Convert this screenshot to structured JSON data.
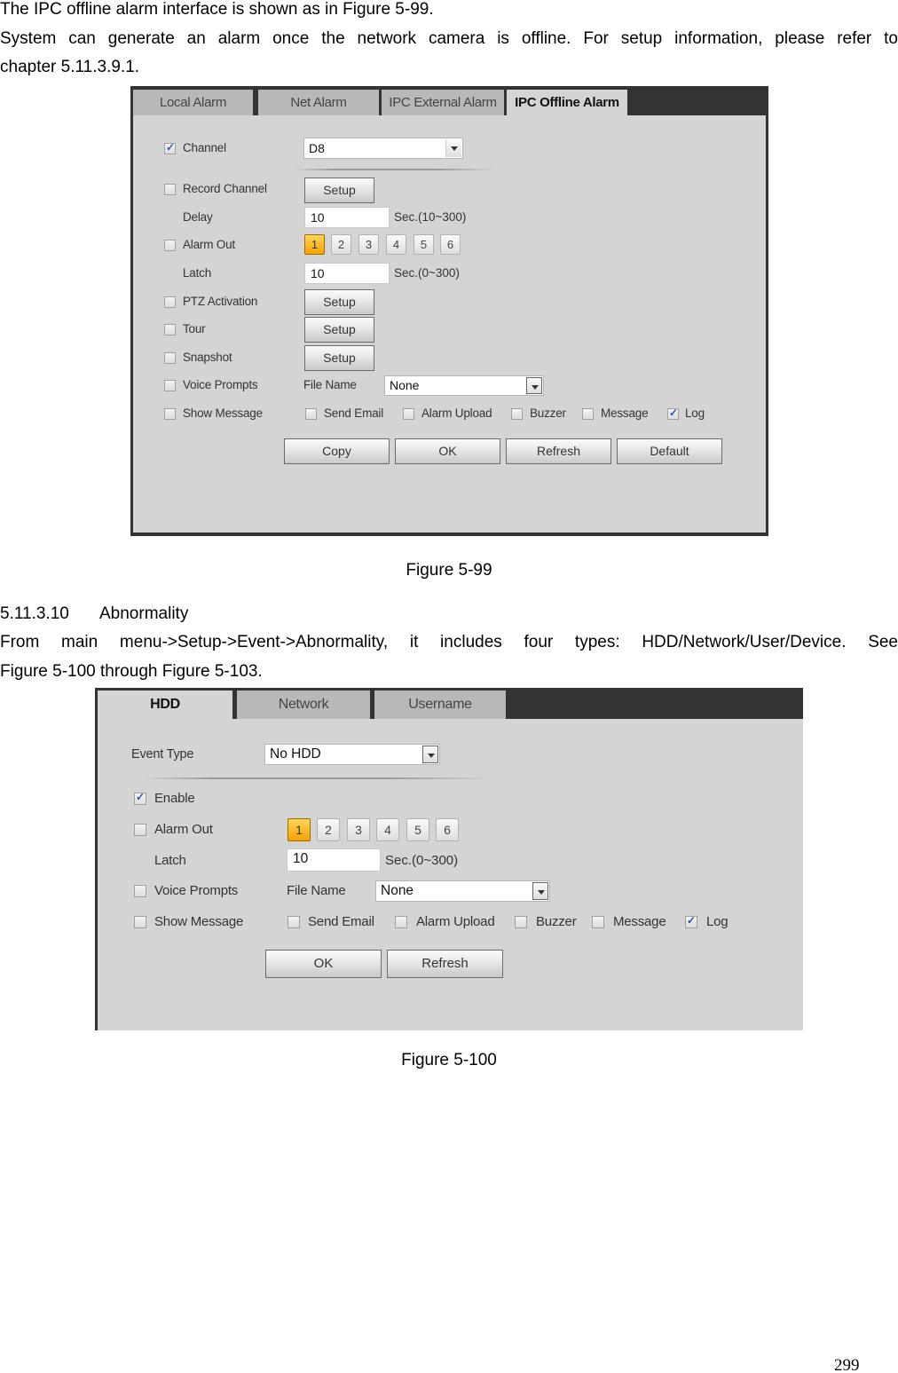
{
  "document": {
    "intro_line": "The IPC offline alarm interface is shown as in Figure 5-99.",
    "intro_para_line1": "System can generate an alarm once the network camera is offline. For setup information, please refer to",
    "intro_para_line2": "chapter 5.11.3.9.1.",
    "figure1_caption": "Figure 5-99",
    "section_number": "5.11.3.10",
    "section_title": "Abnormality",
    "section_para_line1": "From main menu->Setup->Event->Abnormality, it includes four types: HDD/Network/User/Device. See",
    "section_para_line2": "Figure 5-100 through Figure 5-103.",
    "figure2_caption": "Figure 5-100",
    "page_number": "299"
  },
  "figure1": {
    "tabs": [
      {
        "label": "Local Alarm",
        "active": false
      },
      {
        "label": "Net Alarm",
        "active": false
      },
      {
        "label": "IPC External Alarm",
        "active": false
      },
      {
        "label": "IPC Offline Alarm",
        "active": true
      }
    ],
    "channel": {
      "label": "Channel",
      "checked": true,
      "value": "D8"
    },
    "record_channel": {
      "label": "Record Channel",
      "checked": false,
      "button": "Setup"
    },
    "delay": {
      "label": "Delay",
      "value": "10",
      "hint": "Sec.(10~300)"
    },
    "alarm_out": {
      "label": "Alarm Out",
      "checked": false,
      "outputs": [
        "1",
        "2",
        "3",
        "4",
        "5",
        "6"
      ],
      "selected": "1"
    },
    "latch": {
      "label": "Latch",
      "value": "10",
      "hint": "Sec.(0~300)"
    },
    "ptz_activation": {
      "label": "PTZ Activation",
      "checked": false,
      "button": "Setup"
    },
    "tour": {
      "label": "Tour",
      "checked": false,
      "button": "Setup"
    },
    "snapshot": {
      "label": "Snapshot",
      "checked": false,
      "button": "Setup"
    },
    "voice_prompts": {
      "label": "Voice Prompts",
      "checked": false,
      "file_name_label": "File Name",
      "file_name_value": "None"
    },
    "show_message": {
      "label": "Show Message",
      "checked": false
    },
    "notify_options": [
      {
        "label": "Send Email",
        "checked": false
      },
      {
        "label": "Alarm Upload",
        "checked": false
      },
      {
        "label": "Buzzer",
        "checked": false
      },
      {
        "label": "Message",
        "checked": false
      },
      {
        "label": "Log",
        "checked": true
      }
    ],
    "buttons": {
      "copy": "Copy",
      "ok": "OK",
      "refresh": "Refresh",
      "default": "Default"
    }
  },
  "figure2": {
    "tabs": [
      {
        "label": "HDD",
        "active": true
      },
      {
        "label": "Network",
        "active": false
      },
      {
        "label": "Username",
        "active": false
      }
    ],
    "event_type": {
      "label": "Event Type",
      "value": "No HDD"
    },
    "enable": {
      "label": "Enable",
      "checked": true
    },
    "alarm_out": {
      "label": "Alarm Out",
      "checked": false,
      "outputs": [
        "1",
        "2",
        "3",
        "4",
        "5",
        "6"
      ],
      "selected": "1"
    },
    "latch": {
      "label": "Latch",
      "value": "10",
      "hint": "Sec.(0~300)"
    },
    "voice_prompts": {
      "label": "Voice Prompts",
      "checked": false,
      "file_name_label": "File Name",
      "file_name_value": "None"
    },
    "show_message": {
      "label": "Show Message",
      "checked": false
    },
    "notify_options": [
      {
        "label": "Send Email",
        "checked": false
      },
      {
        "label": "Alarm Upload",
        "checked": false
      },
      {
        "label": "Buzzer",
        "checked": false
      },
      {
        "label": "Message",
        "checked": false
      },
      {
        "label": "Log",
        "checked": true
      }
    ],
    "buttons": {
      "ok": "OK",
      "refresh": "Refresh"
    }
  },
  "colors": {
    "panel_bg": "#d4d4d4",
    "tab_bar": "#333333",
    "tab_inactive": "#b8b8b8",
    "selected_output": "#f5a300",
    "check_mark": "#2a4fb5"
  }
}
